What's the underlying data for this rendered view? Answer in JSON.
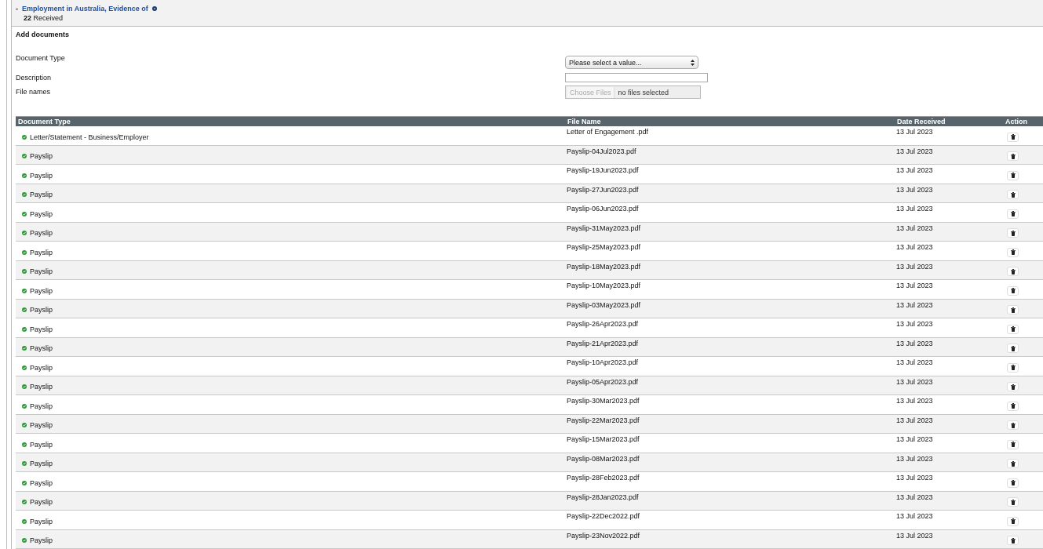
{
  "section": {
    "toggle": "-",
    "title": "Employment in Australia, Evidence of",
    "count": "22",
    "count_label": "Received"
  },
  "form": {
    "heading": "Add documents",
    "fields": [
      {
        "kind": "select",
        "label": "Document Type",
        "value": "Please select a value..."
      },
      {
        "kind": "text",
        "label": "Description"
      },
      {
        "kind": "file",
        "label": "File names",
        "button": "Choose Files",
        "value": "no files selected"
      }
    ]
  },
  "table": {
    "columns": [
      "Document Type",
      "File Name",
      "Date Received",
      "Action"
    ],
    "rows": [
      {
        "type": "Letter/Statement - Business/Employer",
        "file": "Letter of Engagement .pdf",
        "date": "13 Jul 2023"
      },
      {
        "type": "Payslip",
        "file": "Payslip-04Jul2023.pdf",
        "date": "13 Jul 2023"
      },
      {
        "type": "Payslip",
        "file": "Payslip-19Jun2023.pdf",
        "date": "13 Jul 2023"
      },
      {
        "type": "Payslip",
        "file": "Payslip-27Jun2023.pdf",
        "date": "13 Jul 2023"
      },
      {
        "type": "Payslip",
        "file": "Payslip-06Jun2023.pdf",
        "date": "13 Jul 2023"
      },
      {
        "type": "Payslip",
        "file": "Payslip-31May2023.pdf",
        "date": "13 Jul 2023"
      },
      {
        "type": "Payslip",
        "file": "Payslip-25May2023.pdf",
        "date": "13 Jul 2023"
      },
      {
        "type": "Payslip",
        "file": "Payslip-18May2023.pdf",
        "date": "13 Jul 2023"
      },
      {
        "type": "Payslip",
        "file": "Payslip-10May2023.pdf",
        "date": "13 Jul 2023"
      },
      {
        "type": "Payslip",
        "file": "Payslip-03May2023.pdf",
        "date": "13 Jul 2023"
      },
      {
        "type": "Payslip",
        "file": "Payslip-26Apr2023.pdf",
        "date": "13 Jul 2023"
      },
      {
        "type": "Payslip",
        "file": "Payslip-21Apr2023.pdf",
        "date": "13 Jul 2023"
      },
      {
        "type": "Payslip",
        "file": "Payslip-10Apr2023.pdf",
        "date": "13 Jul 2023"
      },
      {
        "type": "Payslip",
        "file": "Payslip-05Apr2023.pdf",
        "date": "13 Jul 2023"
      },
      {
        "type": "Payslip",
        "file": "Payslip-30Mar2023.pdf",
        "date": "13 Jul 2023"
      },
      {
        "type": "Payslip",
        "file": "Payslip-22Mar2023.pdf",
        "date": "13 Jul 2023"
      },
      {
        "type": "Payslip",
        "file": "Payslip-15Mar2023.pdf",
        "date": "13 Jul 2023"
      },
      {
        "type": "Payslip",
        "file": "Payslip-08Mar2023.pdf",
        "date": "13 Jul 2023"
      },
      {
        "type": "Payslip",
        "file": "Payslip-28Feb2023.pdf",
        "date": "13 Jul 2023"
      },
      {
        "type": "Payslip",
        "file": "Payslip-28Jan2023.pdf",
        "date": "13 Jul 2023"
      },
      {
        "type": "Payslip",
        "file": "Payslip-22Dec2022.pdf",
        "date": "13 Jul 2023"
      },
      {
        "type": "Payslip",
        "file": "Payslip-23Nov2022.pdf",
        "date": "13 Jul 2023"
      }
    ]
  }
}
